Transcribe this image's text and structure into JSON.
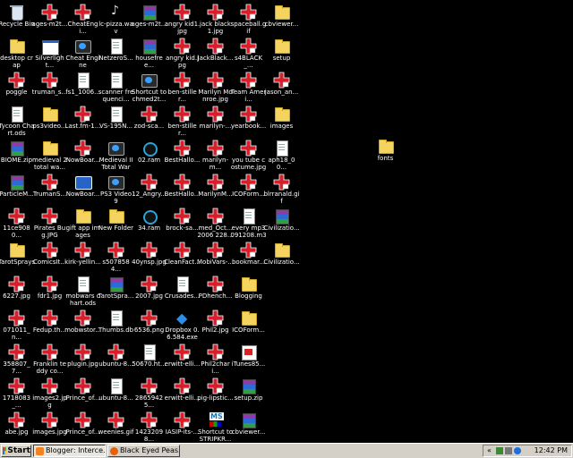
{
  "desktop": {
    "icons": [
      {
        "label": "Recycle Bin",
        "icon": "bin"
      },
      {
        "label": "ages-m2t...",
        "icon": "red"
      },
      {
        "label": "CheatEngi...",
        "icon": "red"
      },
      {
        "label": "lc-pizza.wav",
        "icon": "wav"
      },
      {
        "label": "ages-m2t...",
        "icon": "winrar"
      },
      {
        "label": "angry kid1.jpg",
        "icon": "red"
      },
      {
        "label": "jack black 1.jpg",
        "icon": "red"
      },
      {
        "label": "spaceball.gif",
        "icon": "red"
      },
      {
        "label": "cbviewer...",
        "icon": "folder"
      },
      {
        "label": "desktop crap",
        "icon": "folder"
      },
      {
        "label": "Silverlight...",
        "icon": "window"
      },
      {
        "label": "Cheat Engine",
        "icon": "app"
      },
      {
        "label": "NetzeroS...",
        "icon": "doc"
      },
      {
        "label": "housefree...",
        "icon": "winrar"
      },
      {
        "label": "angry kid.jpg",
        "icon": "red"
      },
      {
        "label": "JackBlack...",
        "icon": "red"
      },
      {
        "label": "s4BLACK_...",
        "icon": "red"
      },
      {
        "label": "setup",
        "icon": "folder"
      },
      {
        "label": "poggle",
        "icon": "red"
      },
      {
        "label": "truman_s...",
        "icon": "red"
      },
      {
        "label": "fs1_1006...",
        "icon": "doc"
      },
      {
        "label": "scanner frequenci...",
        "icon": "doc"
      },
      {
        "label": "Shortcut to chmed2t...",
        "icon": "app"
      },
      {
        "label": "ben-stiller...",
        "icon": "red"
      },
      {
        "label": "Marilyn Monroe.jpg",
        "icon": "red"
      },
      {
        "label": "Team Ameri...",
        "icon": "red"
      },
      {
        "label": "jason_an...",
        "icon": "red"
      },
      {
        "label": "Tycoon Chart.ods",
        "icon": "doc"
      },
      {
        "label": "ps3video...",
        "icon": "folder"
      },
      {
        "label": "Last.fm-1...",
        "icon": "red"
      },
      {
        "label": "VS-195N...",
        "icon": "doc"
      },
      {
        "label": "zod-sca...",
        "icon": "red"
      },
      {
        "label": "ben-stiller...",
        "icon": "red"
      },
      {
        "label": "marilyn-...",
        "icon": "red"
      },
      {
        "label": "yearbook...",
        "icon": "red"
      },
      {
        "label": "images",
        "icon": "folder"
      },
      {
        "label": "BIOME.zip",
        "icon": "winrar"
      },
      {
        "label": "medieval 2 total wa...",
        "icon": "folder"
      },
      {
        "label": "NowBoar...",
        "icon": "red"
      },
      {
        "label": "Medieval II Total War",
        "icon": "app"
      },
      {
        "label": "02.ram",
        "icon": "ring"
      },
      {
        "label": "BestHallo...",
        "icon": "red"
      },
      {
        "label": "marilyn-m...",
        "icon": "red"
      },
      {
        "label": "you tube costume.jpg",
        "icon": "red"
      },
      {
        "label": "aph18_00...",
        "icon": "doc"
      },
      {
        "label": "ParticleM...",
        "icon": "winrar"
      },
      {
        "label": "TrumanS...",
        "icon": "red"
      },
      {
        "label": "NowBoar...",
        "icon": "blue"
      },
      {
        "label": "PS3 Video 9",
        "icon": "app"
      },
      {
        "label": "12_Angry...",
        "icon": "red"
      },
      {
        "label": "BestHallo...",
        "icon": "red"
      },
      {
        "label": "MarilynM...",
        "icon": "red"
      },
      {
        "label": "ICOForm...",
        "icon": "red"
      },
      {
        "label": "blrranald.gif",
        "icon": "red"
      },
      {
        "label": "11ce9080...",
        "icon": "red"
      },
      {
        "label": "Pirates Bug.JPG",
        "icon": "red"
      },
      {
        "label": "gift app images",
        "icon": "folder"
      },
      {
        "label": "New Folder",
        "icon": "folder"
      },
      {
        "label": "34.ram",
        "icon": "ring"
      },
      {
        "label": "brock-sa...",
        "icon": "red"
      },
      {
        "label": "med_Oct... 2006 228...",
        "icon": "red"
      },
      {
        "label": "every mp3 091208.m3u",
        "icon": "doc"
      },
      {
        "label": "Civilizatio...",
        "icon": "winrar"
      },
      {
        "label": "TarotSprays",
        "icon": "folder"
      },
      {
        "label": "ComicsIt...",
        "icon": "red"
      },
      {
        "label": "kirk-yellin...",
        "icon": "red"
      },
      {
        "label": "s5078584...",
        "icon": "red"
      },
      {
        "label": "40ynsp.jpg",
        "icon": "red"
      },
      {
        "label": "CleanFact...",
        "icon": "red"
      },
      {
        "label": "MobiVars-...",
        "icon": "red"
      },
      {
        "label": "bookmar...",
        "icon": "red"
      },
      {
        "label": "Civilizatio...",
        "icon": "folder"
      },
      {
        "label": "6227.jpg",
        "icon": "red"
      },
      {
        "label": "fdr1.jpg",
        "icon": "red"
      },
      {
        "label": "mobwars chart.ods",
        "icon": "doc"
      },
      {
        "label": "TarotSpra...",
        "icon": "winrar"
      },
      {
        "label": "2007.jpg",
        "icon": "red"
      },
      {
        "label": "Crusades...",
        "icon": "doc"
      },
      {
        "label": "PDhench...",
        "icon": "red"
      },
      {
        "label": "Blogging",
        "icon": "folder"
      },
      {
        "label": "071011_n...",
        "icon": "red"
      },
      {
        "label": "Fedup.th...",
        "icon": "red"
      },
      {
        "label": "mobwstor...",
        "icon": "red"
      },
      {
        "label": "Thumbs.db",
        "icon": "doc"
      },
      {
        "label": "6536.png",
        "icon": "red"
      },
      {
        "label": "Dropbox 0.6.584.exe",
        "icon": "dropbox"
      },
      {
        "label": "Phil2.jpg",
        "icon": "red"
      },
      {
        "label": "ICOForm...",
        "icon": "folder"
      },
      {
        "label": "358807_7...",
        "icon": "red"
      },
      {
        "label": "Franklin teddy co...",
        "icon": "red"
      },
      {
        "label": "plugin.jpg",
        "icon": "red"
      },
      {
        "label": "ubuntu-8...",
        "icon": "red"
      },
      {
        "label": "50670.ht...",
        "icon": "doc"
      },
      {
        "label": "erwitt-elli...",
        "icon": "red"
      },
      {
        "label": "Phil2chari...",
        "icon": "red"
      },
      {
        "label": "iTunes85...",
        "icon": "gif"
      },
      {
        "label": "1718083_...",
        "icon": "red"
      },
      {
        "label": "images2.jpg",
        "icon": "red"
      },
      {
        "label": "Prince_of...",
        "icon": "red"
      },
      {
        "label": "ubuntu-8...",
        "icon": "doc"
      },
      {
        "label": "28659425...",
        "icon": "red"
      },
      {
        "label": "erwitt-elli...",
        "icon": "red"
      },
      {
        "label": "pig-lipstic...",
        "icon": "red"
      },
      {
        "label": "setup.zip",
        "icon": "winrar"
      },
      {
        "label": "abe.jpg",
        "icon": "red"
      },
      {
        "label": "images.jpg",
        "icon": "red"
      },
      {
        "label": "Prince_of...",
        "icon": "red"
      },
      {
        "label": "weenies.gif",
        "icon": "red"
      },
      {
        "label": "14232098...",
        "icon": "red"
      },
      {
        "label": "IASIP-its-...",
        "icon": "red"
      },
      {
        "label": "Shortcut to STRIPKR...",
        "icon": "ms"
      },
      {
        "label": "cbviewer...",
        "icon": "winrar"
      },
      {
        "label": "fonts",
        "icon": "folder"
      }
    ]
  },
  "taskbar": {
    "start_label": "Start",
    "tasks": [
      {
        "label": "Blogger: Interce...",
        "icon": "ie"
      },
      {
        "label": "Black Eyed Peas...",
        "icon": "ff"
      }
    ],
    "tray_arrow": "«",
    "clock": "12:42 PM"
  },
  "colors": {
    "desktop_bg": "#000000",
    "taskbar_bg": "#d4d0c8",
    "accent_red": "#d61f2a"
  }
}
